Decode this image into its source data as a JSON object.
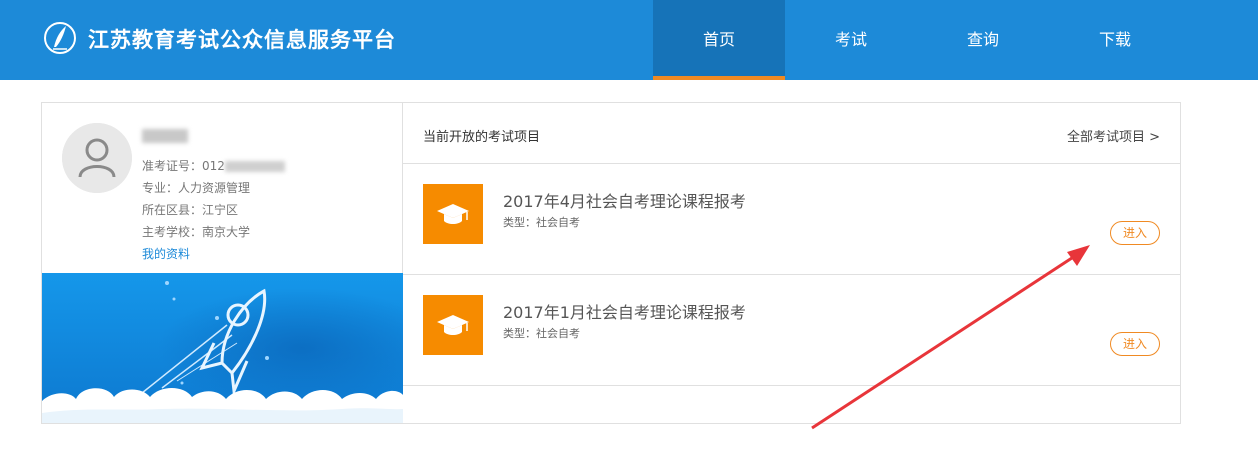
{
  "header": {
    "site_title": "江苏教育考试公众信息服务平台",
    "nav": [
      {
        "label": "首页",
        "active": true
      },
      {
        "label": "考试",
        "active": false
      },
      {
        "label": "查询",
        "active": false
      },
      {
        "label": "下载",
        "active": false
      }
    ]
  },
  "profile": {
    "ticket_label": "准考证号：012",
    "major": "专业：人力资源管理",
    "district": "所在区县：江宁区",
    "school": "主考学校：南京大学",
    "link": "我的资料"
  },
  "exams": {
    "title": "当前开放的考试项目",
    "all_link": "全部考试项目 >",
    "items": [
      {
        "name": "2017年4月社会自考理论课程报考",
        "type": "类型：社会自考",
        "button": "进入"
      },
      {
        "name": "2017年1月社会自考理论课程报考",
        "type": "类型：社会自考",
        "button": "进入"
      }
    ]
  },
  "colors": {
    "header_blue": "#1d8ad8",
    "active_blue": "#1673b8",
    "accent_orange": "#f08a23",
    "icon_orange": "#f68b00",
    "annotation_red": "#e8353a"
  },
  "icons": {
    "logo": "quill-emblem-icon",
    "avatar": "user-avatar-icon",
    "exam": "graduation-cap-icon"
  }
}
